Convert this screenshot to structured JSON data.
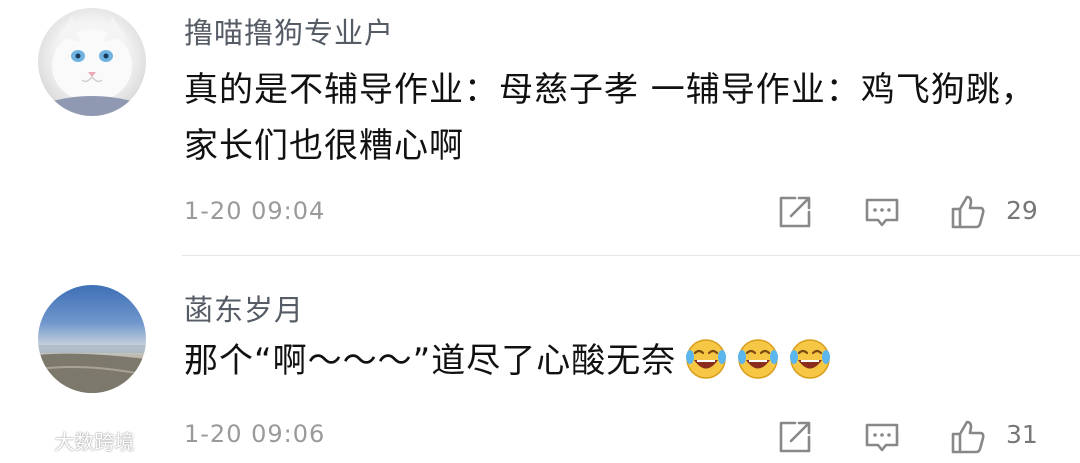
{
  "comments": [
    {
      "username": "撸喵撸狗专业户",
      "text": "真的是不辅导作业：母慈子孝 一辅导作业：鸡飞狗跳，家长们也很糟心啊",
      "time": "1-20 09:04",
      "likes": "29"
    },
    {
      "username": "菡东岁月",
      "text": "那个“啊～～～”道尽了心酸无奈",
      "emoji": [
        "laugh-cry",
        "laugh-cry",
        "laugh-cry"
      ],
      "time": "1-20 09:06",
      "likes": "31"
    }
  ],
  "watermark": "大数跨境",
  "icons": [
    "share-icon",
    "reply-icon",
    "like-icon"
  ],
  "colors": {
    "username": "#555c66",
    "meta": "#9a9a9a",
    "divider": "#e6e6e6"
  }
}
